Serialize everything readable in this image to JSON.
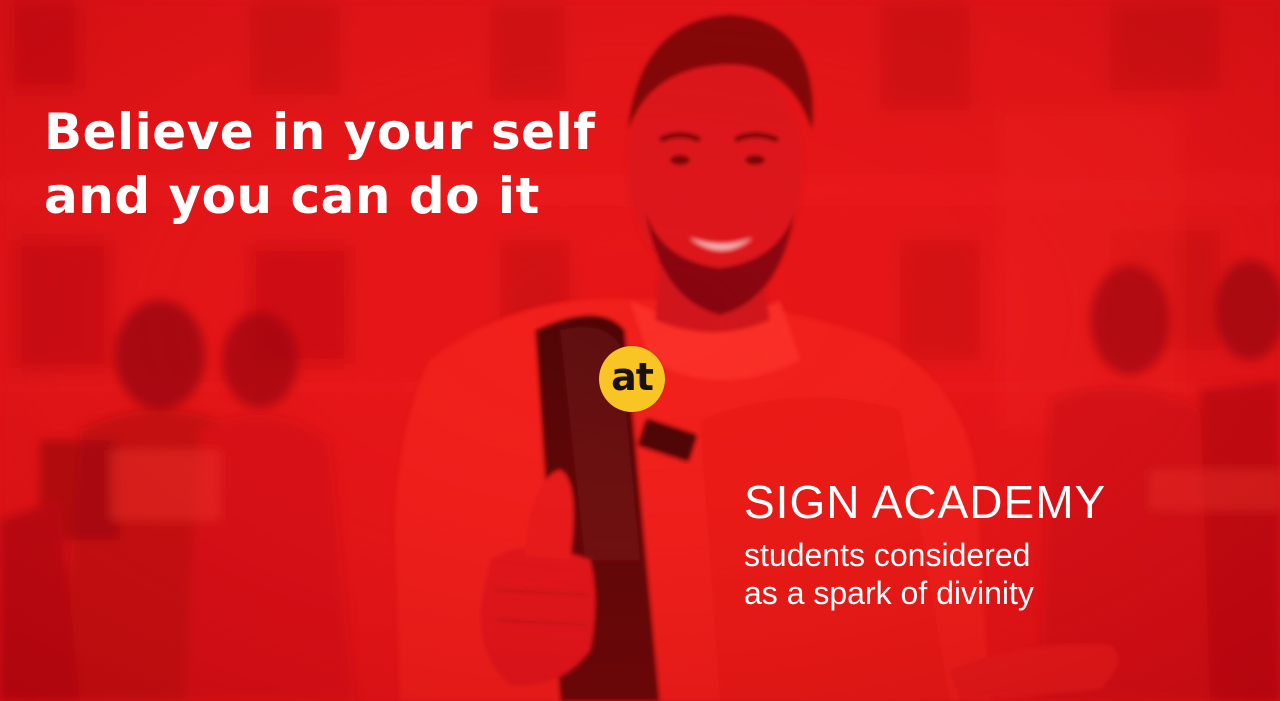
{
  "headline": {
    "line1": "Believe in your self",
    "line2": "and you can do it"
  },
  "logo": {
    "text": "at",
    "color": "#f9c524"
  },
  "brand": {
    "name": "SIGN ACADEMY",
    "tagline_line1": "students considered",
    "tagline_line2": "as a spark of divinity"
  },
  "colors": {
    "background": "#e8141a",
    "text": "#ffffff",
    "logo_text": "#1c1010"
  }
}
